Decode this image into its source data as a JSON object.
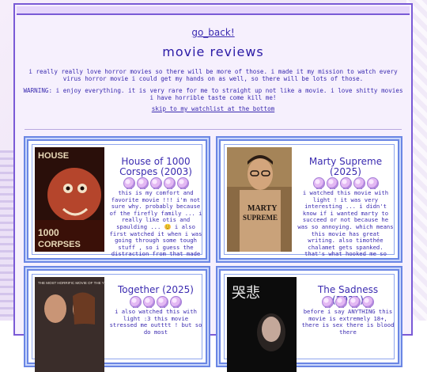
{
  "page": {
    "back_link": "go_back!",
    "title": "movie reviews",
    "intro": "i really really love horror movies so there will be more of those. i made it my mission to watch every virus horror movie i could get my hands on as well, so there will be lots of those.",
    "warning": "WARNING: i enjoy everything. it is very rare for me to straight up not like a movie. i love shitty movies i have horrible taste come kill me!",
    "skip_link": "skip to my watchlist at the bottom"
  },
  "colors": {
    "accent": "#3b2bb0",
    "card_border": "#6a86e4",
    "frame": "#7a5ad6"
  },
  "reviews": [
    {
      "title": "House of 1000 Corspes (2003)",
      "rating_icons": 5,
      "icon": "rating-ghost-icon",
      "review": "this is my comfort and favorite movie !!! i'm not sure why. probably because of the firefly family ... i really like otis and spaulding ... 😊 i also first watched it when i was going through some tough stuff , so i guess the distraction from that made me attached to it ? not sure.",
      "poster_text": "HOUSE OF 1000 CORPSES"
    },
    {
      "title": "Marty Supreme (2025)",
      "rating_icons": 5,
      "icon": "rating-ghost-icon",
      "review": "i watched this movie with light ! it was very interesting ... i didn't know if i wanted marty to succeed or not because he was so annoying. which means this movie has great writing. also timothée chalamet gets spanked. that's what hooked me so maybe it'll hook you",
      "poster_text": "MARTY SUPREME"
    },
    {
      "title": "Together (2025)",
      "rating_icons": 4,
      "icon": "rating-ghost-icon",
      "review": "i also watched this with light :3 this movie stressed me outttt ! but so do most",
      "poster_text": "THE MOST HORRIFIC MOVIE OF THE YEAR"
    },
    {
      "title": "The Sadness (2021)",
      "rating_icons": 4,
      "icon": "rating-ghost-icon",
      "review": "before i say ANYTHING this movie is extremely 18+, there is sex there is blood there",
      "poster_text": "哭悲"
    }
  ]
}
